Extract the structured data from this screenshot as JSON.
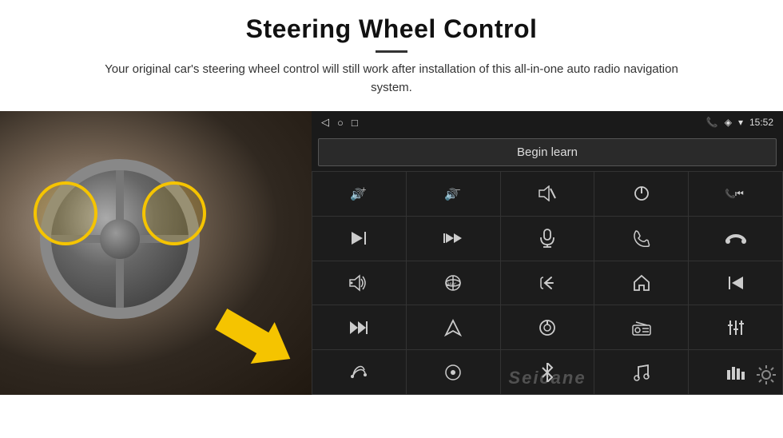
{
  "header": {
    "title": "Steering Wheel Control",
    "subtitle": "Your original car's steering wheel control will still work after installation of this all-in-one auto radio navigation system.",
    "divider": true
  },
  "status_bar": {
    "left_icons": [
      "◁",
      "○",
      "□"
    ],
    "signal_icons": "▪▪",
    "phone_icon": "📞",
    "location_icon": "◈",
    "wifi_icon": "▾",
    "time": "15:52"
  },
  "begin_learn": {
    "label": "Begin learn"
  },
  "watermark": {
    "text": "Seicane"
  },
  "controls": [
    {
      "icon": "🔊+",
      "label": "vol-up"
    },
    {
      "icon": "🔊−",
      "label": "vol-down"
    },
    {
      "icon": "🔇",
      "label": "mute"
    },
    {
      "icon": "⏻",
      "label": "power"
    },
    {
      "icon": "📞⏮",
      "label": "phone-prev"
    },
    {
      "icon": "⏭",
      "label": "next-track"
    },
    {
      "icon": "↯⏭",
      "label": "ff"
    },
    {
      "icon": "🎤",
      "label": "mic"
    },
    {
      "icon": "📞",
      "label": "call"
    },
    {
      "icon": "↩",
      "label": "hang-up"
    },
    {
      "icon": "🔈",
      "label": "speaker"
    },
    {
      "icon": "360",
      "label": "360-cam"
    },
    {
      "icon": "↺",
      "label": "back"
    },
    {
      "icon": "⌂",
      "label": "home"
    },
    {
      "icon": "⏮⏮",
      "label": "prev-track"
    },
    {
      "icon": "⏭⏭",
      "label": "fast-fwd"
    },
    {
      "icon": "▶",
      "label": "play-nav"
    },
    {
      "icon": "⏺",
      "label": "source"
    },
    {
      "icon": "📻",
      "label": "radio"
    },
    {
      "icon": "≡↕",
      "label": "equalizer"
    },
    {
      "icon": "🎤",
      "label": "mic2"
    },
    {
      "icon": "⊙",
      "label": "menu"
    },
    {
      "icon": "✱",
      "label": "bluetooth"
    },
    {
      "icon": "♫",
      "label": "music"
    },
    {
      "icon": "▌▌▌",
      "label": "audio-vis"
    }
  ]
}
